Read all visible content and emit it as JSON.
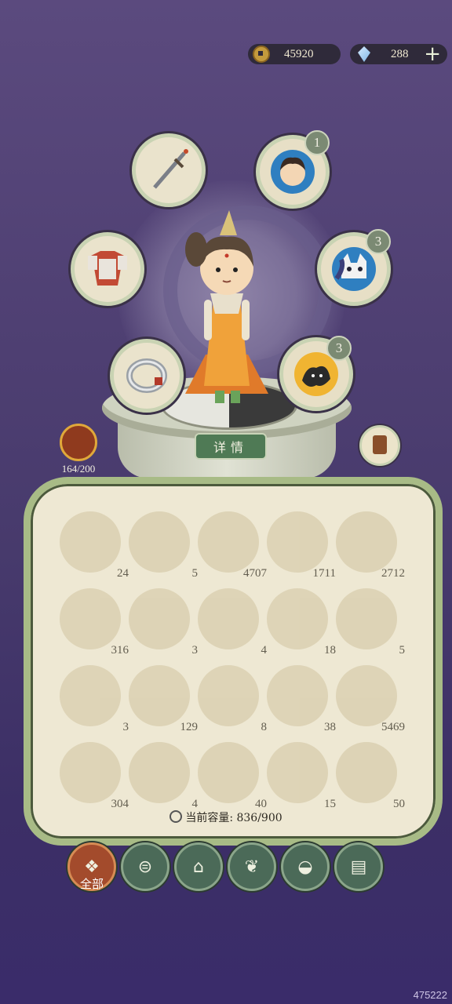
{
  "currency": {
    "coins": "45920",
    "gems": "288",
    "plus": "+"
  },
  "equipment": [
    {
      "name": "sword-slot",
      "icon": "sword-icon"
    },
    {
      "name": "armor-slot",
      "icon": "armor-icon"
    },
    {
      "name": "bracelet-slot",
      "icon": "bracelet-icon"
    }
  ],
  "pets": [
    {
      "name": "pet-slot-1",
      "icon": "boy-portrait-icon",
      "badge": "1"
    },
    {
      "name": "pet-slot-2",
      "icon": "cat-spirit-icon",
      "badge": "3"
    },
    {
      "name": "pet-slot-3",
      "icon": "dark-spirit-icon",
      "badge": "3"
    }
  ],
  "detail_button": "详情",
  "stamina": "164/200",
  "inventory": {
    "counts": [
      "24",
      "5",
      "4707",
      "1711",
      "2712",
      "316",
      "3",
      "4",
      "18",
      "5",
      "3",
      "129",
      "8",
      "38",
      "5469",
      "304",
      "4",
      "40",
      "15",
      "50"
    ],
    "capacity_label": "当前容量: 836/900"
  },
  "tabs": [
    {
      "label": "全部",
      "icon": "grid-icon"
    },
    {
      "label": "",
      "icon": "log-icon"
    },
    {
      "label": "",
      "icon": "building-icon"
    },
    {
      "label": "",
      "icon": "herb-icon"
    },
    {
      "label": "",
      "icon": "bowl-icon"
    },
    {
      "label": "",
      "icon": "scroll-icon"
    }
  ],
  "watermark": "475222"
}
